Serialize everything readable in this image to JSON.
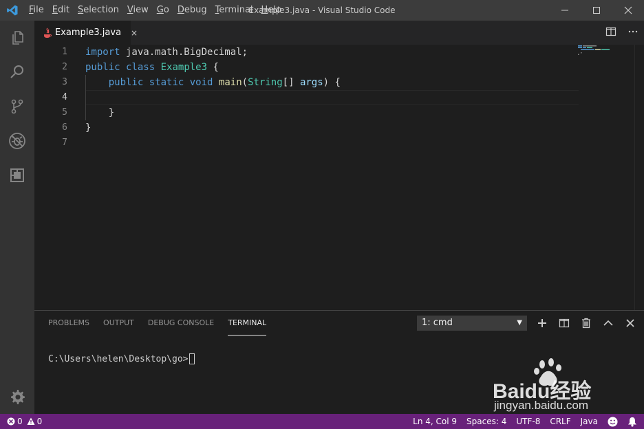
{
  "window": {
    "title": "Example3.java - Visual Studio Code",
    "menu": [
      {
        "label": "File",
        "key": "F",
        "rest": "ile"
      },
      {
        "label": "Edit",
        "key": "E",
        "rest": "dit"
      },
      {
        "label": "Selection",
        "key": "S",
        "rest": "election"
      },
      {
        "label": "View",
        "key": "V",
        "rest": "iew"
      },
      {
        "label": "Go",
        "key": "G",
        "rest": "o"
      },
      {
        "label": "Debug",
        "key": "D",
        "rest": "ebug"
      },
      {
        "label": "Terminal",
        "key": "T",
        "rest": "erminal"
      },
      {
        "label": "Help",
        "key": "H",
        "rest": "elp"
      }
    ],
    "controls": {
      "minimize": "─",
      "maximize": "☐",
      "close": "✕"
    }
  },
  "activity_bar": {
    "items": [
      "explorer-icon",
      "search-icon",
      "source-control-icon",
      "debug-icon",
      "extensions-icon"
    ],
    "bottom": "gear-icon"
  },
  "tabs": [
    {
      "label": "Example3.java",
      "close": "×",
      "icon": "java-icon"
    }
  ],
  "editor": {
    "lines": [
      {
        "n": "1",
        "tokens": [
          {
            "t": "import",
            "c": "kw"
          },
          {
            "t": " java.math.BigDecimal;",
            "c": "tx"
          }
        ]
      },
      {
        "n": "2",
        "tokens": [
          {
            "t": "public",
            "c": "kw"
          },
          {
            "t": " ",
            "c": "tx"
          },
          {
            "t": "class",
            "c": "kw"
          },
          {
            "t": " ",
            "c": "tx"
          },
          {
            "t": "Example3",
            "c": "ty"
          },
          {
            "t": " {",
            "c": "tx"
          }
        ]
      },
      {
        "n": "3",
        "tokens": [
          {
            "t": "    ",
            "c": "tx"
          },
          {
            "t": "public",
            "c": "kw"
          },
          {
            "t": " ",
            "c": "tx"
          },
          {
            "t": "static",
            "c": "kw"
          },
          {
            "t": " ",
            "c": "tx"
          },
          {
            "t": "void",
            "c": "kw"
          },
          {
            "t": " ",
            "c": "tx"
          },
          {
            "t": "main",
            "c": "fn"
          },
          {
            "t": "(",
            "c": "tx"
          },
          {
            "t": "String",
            "c": "ty"
          },
          {
            "t": "[] ",
            "c": "tx"
          },
          {
            "t": "args",
            "c": "vr"
          },
          {
            "t": ") {",
            "c": "tx"
          }
        ]
      },
      {
        "n": "4",
        "tokens": []
      },
      {
        "n": "5",
        "tokens": [
          {
            "t": "    }",
            "c": "tx"
          }
        ]
      },
      {
        "n": "6",
        "tokens": [
          {
            "t": "}",
            "c": "tx"
          }
        ]
      },
      {
        "n": "7",
        "tokens": []
      }
    ],
    "active_line": "4"
  },
  "panel": {
    "tabs": [
      {
        "label": "PROBLEMS",
        "active": false
      },
      {
        "label": "OUTPUT",
        "active": false
      },
      {
        "label": "DEBUG CONSOLE",
        "active": false
      },
      {
        "label": "TERMINAL",
        "active": true
      }
    ],
    "terminal_select": "1: cmd",
    "prompt": "C:\\Users\\helen\\Desktop\\go>"
  },
  "status_bar": {
    "errors": "0",
    "warnings": "0",
    "position": "Ln 4, Col 9",
    "spaces": "Spaces: 4",
    "encoding": "UTF-8",
    "eol": "CRLF",
    "language": "Java"
  },
  "watermark": {
    "brand": "Baidu经验",
    "url": "jingyan.baidu.com"
  },
  "colors": {
    "status_bar": "#68217a",
    "accent": "#007acc"
  }
}
